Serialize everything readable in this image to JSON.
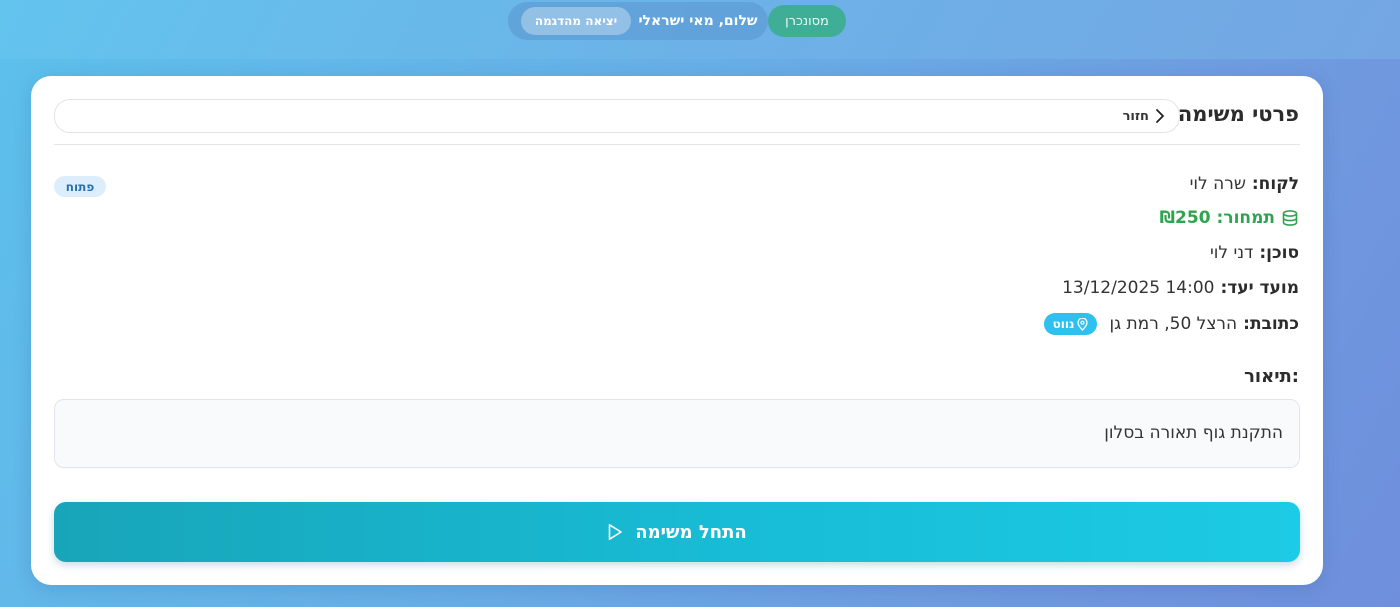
{
  "topbar": {
    "exit_demo": "יציאה מהדגמה",
    "greeting": "שלום, מאי ישראלי",
    "sync_status": "מסונכרן"
  },
  "header": {
    "title": "פרטי משימה",
    "back_label": "חזור"
  },
  "task": {
    "status": "פתוח",
    "customer_label": "לקוח:",
    "customer_value": "שרה לוי",
    "revenue_label": "תמחור:",
    "revenue_value": "₪250",
    "agent_label": "סוכן:",
    "agent_value": "דני לוי",
    "deadline_label": "מועד יעד:",
    "deadline_value": "13/12/2025 14:00",
    "address_label": "כתובת:",
    "address_value": "הרצל 50, רמת גן",
    "navigate_label": "נווט",
    "description_label": "תיאור:",
    "description_value": "התקנת גוף תאורה בסלון"
  },
  "actions": {
    "start_task": "התחל משימה"
  },
  "colors": {
    "accent": "#18bcd6",
    "revenue": "#2ea44f",
    "sync": "#3fae96",
    "status_badge": "#dceefb"
  },
  "icons": [
    "back-chevron-icon",
    "coins-icon",
    "map-pin-icon",
    "play-icon"
  ]
}
